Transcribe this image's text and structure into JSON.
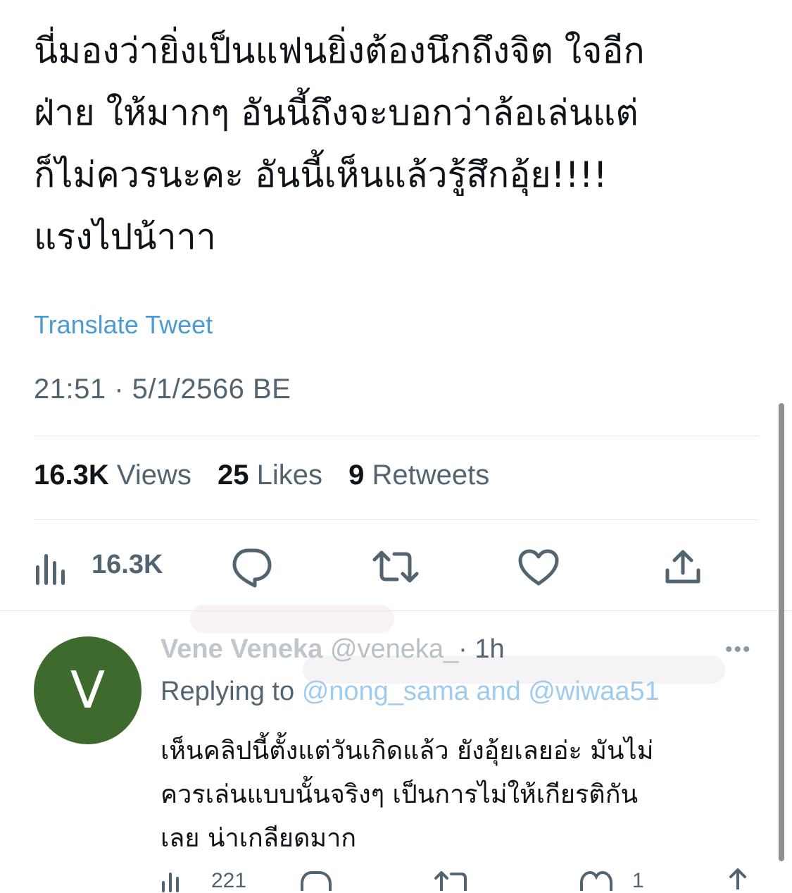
{
  "tweet": {
    "text_lines": [
      "นี่มองว่ายิ่งเป็นแฟนยิ่งต้องนึกถึงจิต ใจอีก",
      "ฝ่าย ให้มากๆ อันนี้ถึงจะบอกว่าล้อเล่นแต่",
      "ก็ไม่ควรนะคะ อันนี้เห็นแล้วรู้สึกอุ้ย!!!!",
      "แรงไปน้าาา"
    ],
    "translate_label": "Translate Tweet",
    "timestamp": "21:51 · 5/1/2566 BE"
  },
  "stats": {
    "views_count": "16.3K",
    "views_label": "Views",
    "likes_count": "25",
    "likes_label": "Likes",
    "retweets_count": "9",
    "retweets_label": "Retweets"
  },
  "action_bar": {
    "views_count": "16.3K",
    "icons": [
      "analytics-icon",
      "reply-icon",
      "retweet-icon",
      "like-icon",
      "share-icon"
    ]
  },
  "reply": {
    "avatar_letter": "V",
    "name": "Vene Veneka",
    "handle": "@veneka_",
    "time": "· 1h",
    "more_label": "•••",
    "replying_to_label": "Replying to",
    "mentions": "@nong_sama and @wiwaa51",
    "text_lines": [
      "เห็นคลิปนี้ตั้งแต่วันเกิดแล้ว ยังอุ้ยเลยอ่ะ มันไม่",
      "ควรเล่นแบบนั้นจริงๆ เป็นการไม่ให้เกียรติกัน",
      "เลย น่าเกลียดมาก"
    ],
    "views_count": "221",
    "likes_count": "1"
  },
  "colors": {
    "link": "#4a9ad4",
    "secondary_text": "#536471",
    "avatar_bg": "#3e6b2d",
    "divider": "#e1e6ea"
  }
}
